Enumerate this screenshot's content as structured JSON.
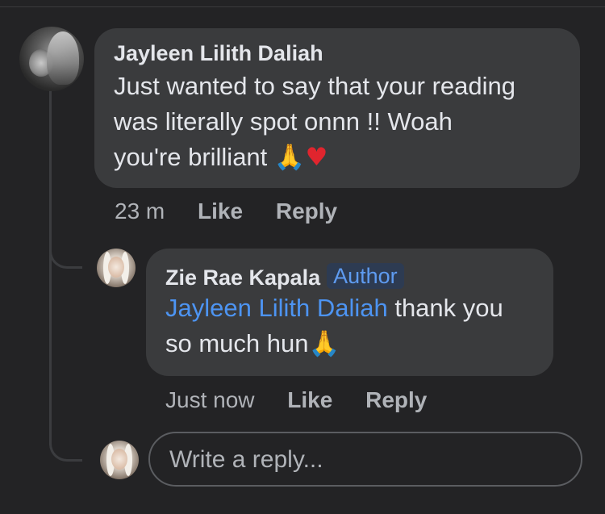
{
  "comment": {
    "author": "Jayleen Lilith Daliah",
    "text_line1": "Just wanted to say that your reading",
    "text_line2": "was literally spot onnn !! Woah",
    "text_line3": "you're brilliant",
    "emoji_1": "🙏",
    "emoji_2": "♥",
    "timestamp": "23 m",
    "like_label": "Like",
    "reply_label": "Reply"
  },
  "reply": {
    "author": "Zie Rae Kapala",
    "badge": "Author",
    "mention": "Jayleen Lilith Daliah",
    "text_after_mention": " thank you",
    "text_line2": "so much hun",
    "emoji": "🙏",
    "timestamp": "Just now",
    "like_label": "Like",
    "reply_label": "Reply"
  },
  "composer": {
    "placeholder": "Write a reply..."
  },
  "colors": {
    "background": "#232325",
    "bubble": "#3a3b3d",
    "mention": "#4d94f2",
    "badge_text": "#5e9bf0",
    "secondary_text": "#b0b3b8"
  }
}
